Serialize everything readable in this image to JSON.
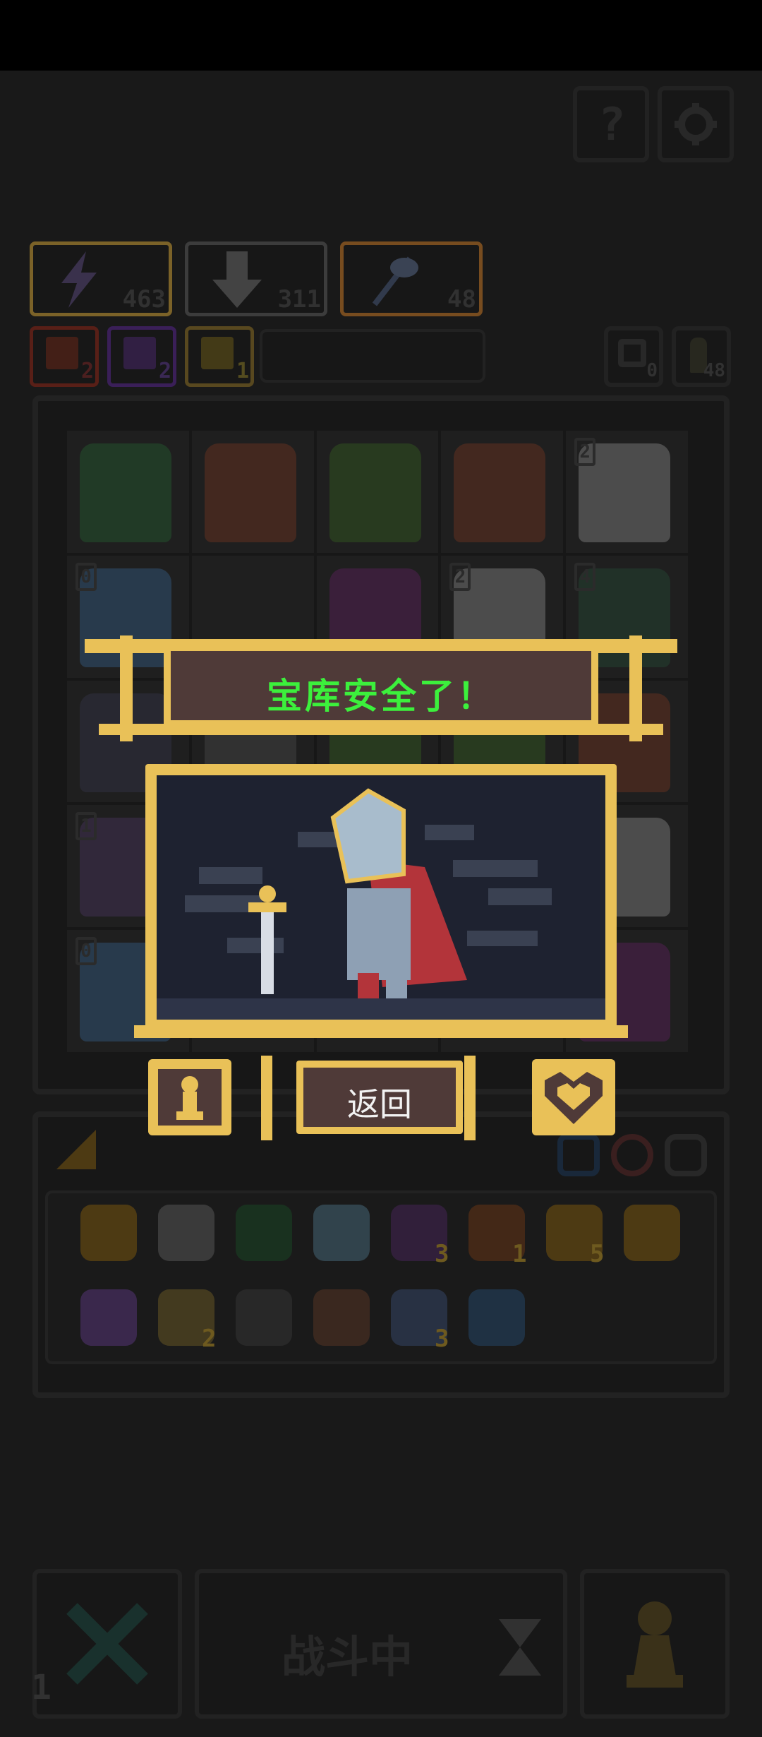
{
  "colors": {
    "banner_text": "#3cf03c",
    "frame_gold": "#e9c158",
    "panel_bg": "#2b2b2b",
    "panel_border": "#3f3f3f",
    "banner_bg": "#5a3a3a"
  },
  "top_buttons": [
    {
      "icon": "help-icon",
      "label": "?"
    },
    {
      "icon": "gear-icon"
    }
  ],
  "resources": [
    {
      "icon": "lightning-icon",
      "value": "463",
      "border": "#e1b34a"
    },
    {
      "icon": "down-arrow-icon",
      "value": "311",
      "border": "#6d6d6d"
    },
    {
      "icon": "axe-icon",
      "value": "48",
      "border": "#d98a3a"
    }
  ],
  "boosts": [
    {
      "icon": "fire-boost-icon",
      "value": "2",
      "border": "#d24a2a"
    },
    {
      "icon": "lightning-boost-icon",
      "value": "2",
      "border": "#8d4ad2"
    },
    {
      "icon": "arrow-up-boost-icon",
      "value": "1",
      "border": "#e1b34a"
    }
  ],
  "side_counters": [
    {
      "icon": "refresh-icon",
      "value": "0"
    },
    {
      "icon": "key-icon",
      "value": "48"
    }
  ],
  "grid_cells": [
    {
      "level": "",
      "color": "#3d6b46"
    },
    {
      "level": "",
      "color": "#7a4a3a"
    },
    {
      "level": "",
      "color": "#4a6a3a"
    },
    {
      "level": "",
      "color": "#7a4a3a"
    },
    {
      "level": "2",
      "color": "#8a8a8a"
    },
    {
      "level": "0",
      "color": "#4a6a8a"
    },
    {
      "level": "",
      "color": "#3a3a3a"
    },
    {
      "level": "",
      "color": "#6a3a6a"
    },
    {
      "level": "2",
      "color": "#8a8a8a"
    },
    {
      "level": "4",
      "color": "#3d5a4a"
    },
    {
      "level": "",
      "color": "#4a4a5a"
    },
    {
      "level": "",
      "color": "#5a5a5a"
    },
    {
      "level": "",
      "color": "#4a6a3a"
    },
    {
      "level": "",
      "color": "#4a6a3a"
    },
    {
      "level": "",
      "color": "#7a4a3a"
    },
    {
      "level": "1",
      "color": "#5a4a6a"
    },
    {
      "level": "",
      "color": "#3a3a3a"
    },
    {
      "level": "",
      "color": "#3a3a3a"
    },
    {
      "level": "",
      "color": "#3a3a3a"
    },
    {
      "level": "",
      "color": "#8a8a8a"
    },
    {
      "level": "0",
      "color": "#4a6a8a"
    },
    {
      "level": "",
      "color": "#3a3a3a"
    },
    {
      "level": "",
      "color": "#3a3a3a"
    },
    {
      "level": "",
      "color": "#3a3a3a"
    },
    {
      "level": "",
      "color": "#6a3a6a"
    }
  ],
  "dialog": {
    "title": "宝库安全了！",
    "return_button": "返回",
    "left_icon": "pawn-icon",
    "right_icon": "heart-icon"
  },
  "inventory_tabs": [
    {
      "icon": "shield-tab-icon"
    },
    {
      "icon": "ring-tab-icon"
    },
    {
      "icon": "skull-tab-icon"
    }
  ],
  "inventory_row1": [
    {
      "icon": "coin-icon",
      "count": ""
    },
    {
      "icon": "flower-icon",
      "count": ""
    },
    {
      "icon": "map-icon",
      "count": ""
    },
    {
      "icon": "mask-icon",
      "count": ""
    },
    {
      "icon": "demon-icon",
      "count": "3"
    },
    {
      "icon": "boot-icon",
      "count": "1"
    },
    {
      "icon": "bow-icon",
      "count": "5"
    },
    {
      "icon": "totem-icon",
      "count": ""
    }
  ],
  "inventory_row2": [
    {
      "icon": "staff-icon",
      "count": ""
    },
    {
      "icon": "star-icon",
      "count": "2"
    },
    {
      "icon": "spider-icon",
      "count": ""
    },
    {
      "icon": "slingshot-icon",
      "count": ""
    },
    {
      "icon": "axe-item-icon",
      "count": "3"
    },
    {
      "icon": "potion-icon",
      "count": ""
    }
  ],
  "bottom_bar": {
    "battle_label": "战斗中",
    "left_counter": "1"
  }
}
